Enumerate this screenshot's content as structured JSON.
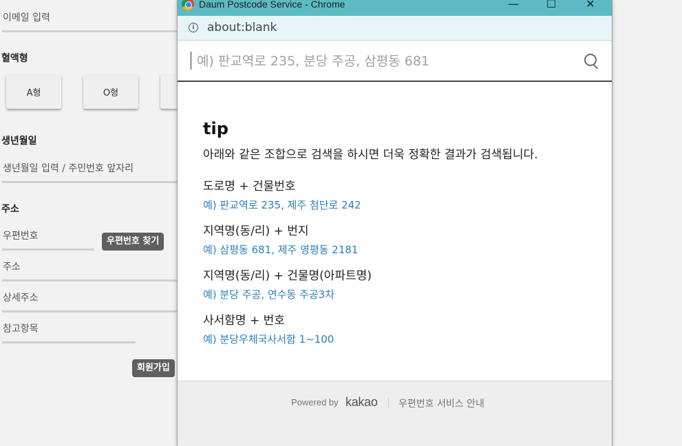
{
  "form": {
    "email_placeholder": "이메일 입력",
    "blood_label": "혈액형",
    "blood_options": [
      "A형",
      "O형"
    ],
    "birth_label": "생년월일",
    "birth_placeholder": "생년월일 입력 / 주민번호 앞자리",
    "address_label": "주소",
    "zipcode_placeholder": "우편번호",
    "find_zipcode_button": "우편번호 찾기",
    "address_placeholder": "주소",
    "detail_address_placeholder": "상세주소",
    "reference_placeholder": "참고항목",
    "signup_button": "회원가입"
  },
  "popup": {
    "window_title": "Daum Postcode Service - Chrome",
    "controls": {
      "minimize": "—",
      "maximize": "☐",
      "close": "✕"
    },
    "url": "about:blank",
    "search_placeholder": "예) 판교역로 235, 분당 주공, 삼평동 681",
    "tip": {
      "title": "tip",
      "description": "아래와 같은 조합으로 검색을 하시면 더욱 정확한 결과가 검색됩니다.",
      "items": [
        {
          "head": "도로명 + 건물번호",
          "example": "예) 판교역로 235,  제주 첨단로 242"
        },
        {
          "head": "지역명(동/리) + 번지",
          "example": "예) 삼평동 681,  제주 영평동 2181"
        },
        {
          "head": "지역명(동/리) + 건물명(아파트명)",
          "example": "예) 분당 주공,  연수동 주공3차"
        },
        {
          "head": "사서함명 + 번호",
          "example": "예) 분당우체국사서함 1~100"
        }
      ]
    },
    "footer": {
      "powered_by": "Powered by",
      "brand": "kakao",
      "service_guide": "우편번호 서비스 안내"
    }
  },
  "colors": {
    "titlebar": "#5bbac3",
    "addressbar": "#e6f6f8",
    "example_link": "#2a7fc1",
    "dark_button": "#5f5f5f"
  }
}
